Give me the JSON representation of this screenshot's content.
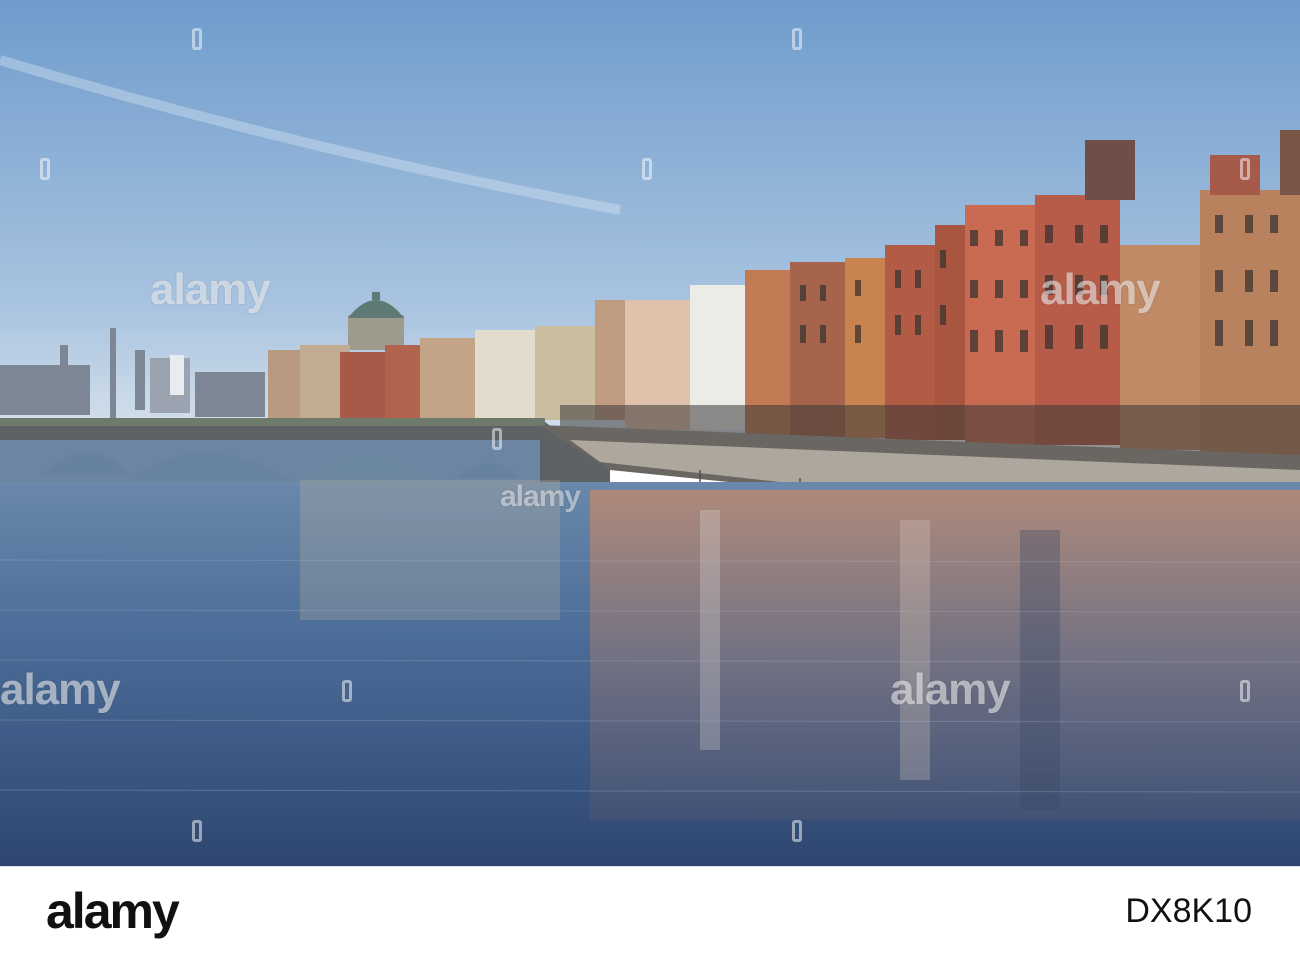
{
  "photo": {
    "subject": "river quay with bridge, domed building and terraced facades reflected in water",
    "colors": {
      "sky_top": "#6f9ccc",
      "sky_bottom": "#c9dbea",
      "water_top": "#5b7fa7",
      "water_bottom": "#2f4a73",
      "brick": "#b6674e",
      "stone": "#c9b79a",
      "shadow": "#3a3a3a"
    }
  },
  "watermarks": {
    "text": "alamy"
  },
  "footer": {
    "logo": "alamy",
    "image_id": "DX8K10"
  }
}
